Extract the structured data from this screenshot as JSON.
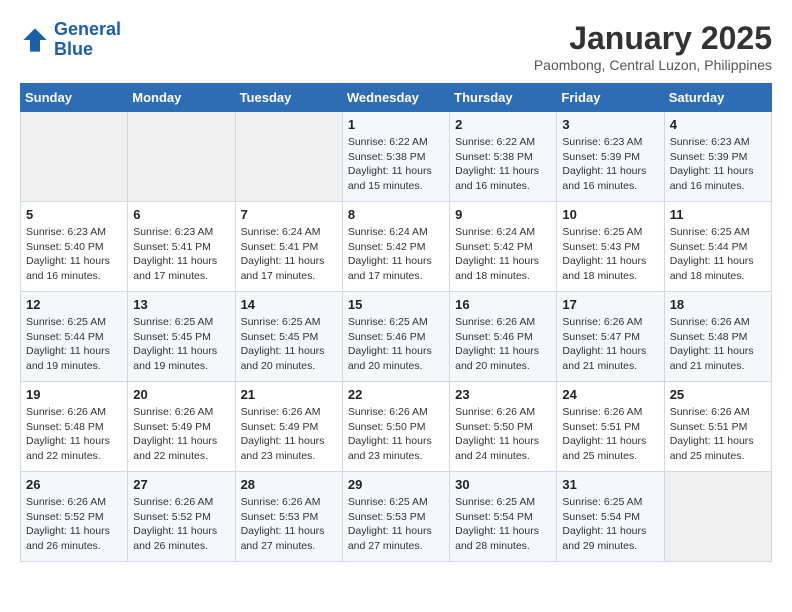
{
  "logo": {
    "line1": "General",
    "line2": "Blue"
  },
  "title": "January 2025",
  "location": "Paombong, Central Luzon, Philippines",
  "weekdays": [
    "Sunday",
    "Monday",
    "Tuesday",
    "Wednesday",
    "Thursday",
    "Friday",
    "Saturday"
  ],
  "weeks": [
    [
      {
        "day": "",
        "empty": true
      },
      {
        "day": "",
        "empty": true
      },
      {
        "day": "",
        "empty": true
      },
      {
        "day": "1",
        "sunrise": "Sunrise: 6:22 AM",
        "sunset": "Sunset: 5:38 PM",
        "daylight": "Daylight: 11 hours and 15 minutes."
      },
      {
        "day": "2",
        "sunrise": "Sunrise: 6:22 AM",
        "sunset": "Sunset: 5:38 PM",
        "daylight": "Daylight: 11 hours and 16 minutes."
      },
      {
        "day": "3",
        "sunrise": "Sunrise: 6:23 AM",
        "sunset": "Sunset: 5:39 PM",
        "daylight": "Daylight: 11 hours and 16 minutes."
      },
      {
        "day": "4",
        "sunrise": "Sunrise: 6:23 AM",
        "sunset": "Sunset: 5:39 PM",
        "daylight": "Daylight: 11 hours and 16 minutes."
      }
    ],
    [
      {
        "day": "5",
        "sunrise": "Sunrise: 6:23 AM",
        "sunset": "Sunset: 5:40 PM",
        "daylight": "Daylight: 11 hours and 16 minutes."
      },
      {
        "day": "6",
        "sunrise": "Sunrise: 6:23 AM",
        "sunset": "Sunset: 5:41 PM",
        "daylight": "Daylight: 11 hours and 17 minutes."
      },
      {
        "day": "7",
        "sunrise": "Sunrise: 6:24 AM",
        "sunset": "Sunset: 5:41 PM",
        "daylight": "Daylight: 11 hours and 17 minutes."
      },
      {
        "day": "8",
        "sunrise": "Sunrise: 6:24 AM",
        "sunset": "Sunset: 5:42 PM",
        "daylight": "Daylight: 11 hours and 17 minutes."
      },
      {
        "day": "9",
        "sunrise": "Sunrise: 6:24 AM",
        "sunset": "Sunset: 5:42 PM",
        "daylight": "Daylight: 11 hours and 18 minutes."
      },
      {
        "day": "10",
        "sunrise": "Sunrise: 6:25 AM",
        "sunset": "Sunset: 5:43 PM",
        "daylight": "Daylight: 11 hours and 18 minutes."
      },
      {
        "day": "11",
        "sunrise": "Sunrise: 6:25 AM",
        "sunset": "Sunset: 5:44 PM",
        "daylight": "Daylight: 11 hours and 18 minutes."
      }
    ],
    [
      {
        "day": "12",
        "sunrise": "Sunrise: 6:25 AM",
        "sunset": "Sunset: 5:44 PM",
        "daylight": "Daylight: 11 hours and 19 minutes."
      },
      {
        "day": "13",
        "sunrise": "Sunrise: 6:25 AM",
        "sunset": "Sunset: 5:45 PM",
        "daylight": "Daylight: 11 hours and 19 minutes."
      },
      {
        "day": "14",
        "sunrise": "Sunrise: 6:25 AM",
        "sunset": "Sunset: 5:45 PM",
        "daylight": "Daylight: 11 hours and 20 minutes."
      },
      {
        "day": "15",
        "sunrise": "Sunrise: 6:25 AM",
        "sunset": "Sunset: 5:46 PM",
        "daylight": "Daylight: 11 hours and 20 minutes."
      },
      {
        "day": "16",
        "sunrise": "Sunrise: 6:26 AM",
        "sunset": "Sunset: 5:46 PM",
        "daylight": "Daylight: 11 hours and 20 minutes."
      },
      {
        "day": "17",
        "sunrise": "Sunrise: 6:26 AM",
        "sunset": "Sunset: 5:47 PM",
        "daylight": "Daylight: 11 hours and 21 minutes."
      },
      {
        "day": "18",
        "sunrise": "Sunrise: 6:26 AM",
        "sunset": "Sunset: 5:48 PM",
        "daylight": "Daylight: 11 hours and 21 minutes."
      }
    ],
    [
      {
        "day": "19",
        "sunrise": "Sunrise: 6:26 AM",
        "sunset": "Sunset: 5:48 PM",
        "daylight": "Daylight: 11 hours and 22 minutes."
      },
      {
        "day": "20",
        "sunrise": "Sunrise: 6:26 AM",
        "sunset": "Sunset: 5:49 PM",
        "daylight": "Daylight: 11 hours and 22 minutes."
      },
      {
        "day": "21",
        "sunrise": "Sunrise: 6:26 AM",
        "sunset": "Sunset: 5:49 PM",
        "daylight": "Daylight: 11 hours and 23 minutes."
      },
      {
        "day": "22",
        "sunrise": "Sunrise: 6:26 AM",
        "sunset": "Sunset: 5:50 PM",
        "daylight": "Daylight: 11 hours and 23 minutes."
      },
      {
        "day": "23",
        "sunrise": "Sunrise: 6:26 AM",
        "sunset": "Sunset: 5:50 PM",
        "daylight": "Daylight: 11 hours and 24 minutes."
      },
      {
        "day": "24",
        "sunrise": "Sunrise: 6:26 AM",
        "sunset": "Sunset: 5:51 PM",
        "daylight": "Daylight: 11 hours and 25 minutes."
      },
      {
        "day": "25",
        "sunrise": "Sunrise: 6:26 AM",
        "sunset": "Sunset: 5:51 PM",
        "daylight": "Daylight: 11 hours and 25 minutes."
      }
    ],
    [
      {
        "day": "26",
        "sunrise": "Sunrise: 6:26 AM",
        "sunset": "Sunset: 5:52 PM",
        "daylight": "Daylight: 11 hours and 26 minutes."
      },
      {
        "day": "27",
        "sunrise": "Sunrise: 6:26 AM",
        "sunset": "Sunset: 5:52 PM",
        "daylight": "Daylight: 11 hours and 26 minutes."
      },
      {
        "day": "28",
        "sunrise": "Sunrise: 6:26 AM",
        "sunset": "Sunset: 5:53 PM",
        "daylight": "Daylight: 11 hours and 27 minutes."
      },
      {
        "day": "29",
        "sunrise": "Sunrise: 6:25 AM",
        "sunset": "Sunset: 5:53 PM",
        "daylight": "Daylight: 11 hours and 27 minutes."
      },
      {
        "day": "30",
        "sunrise": "Sunrise: 6:25 AM",
        "sunset": "Sunset: 5:54 PM",
        "daylight": "Daylight: 11 hours and 28 minutes."
      },
      {
        "day": "31",
        "sunrise": "Sunrise: 6:25 AM",
        "sunset": "Sunset: 5:54 PM",
        "daylight": "Daylight: 11 hours and 29 minutes."
      },
      {
        "day": "",
        "empty": true
      }
    ]
  ]
}
